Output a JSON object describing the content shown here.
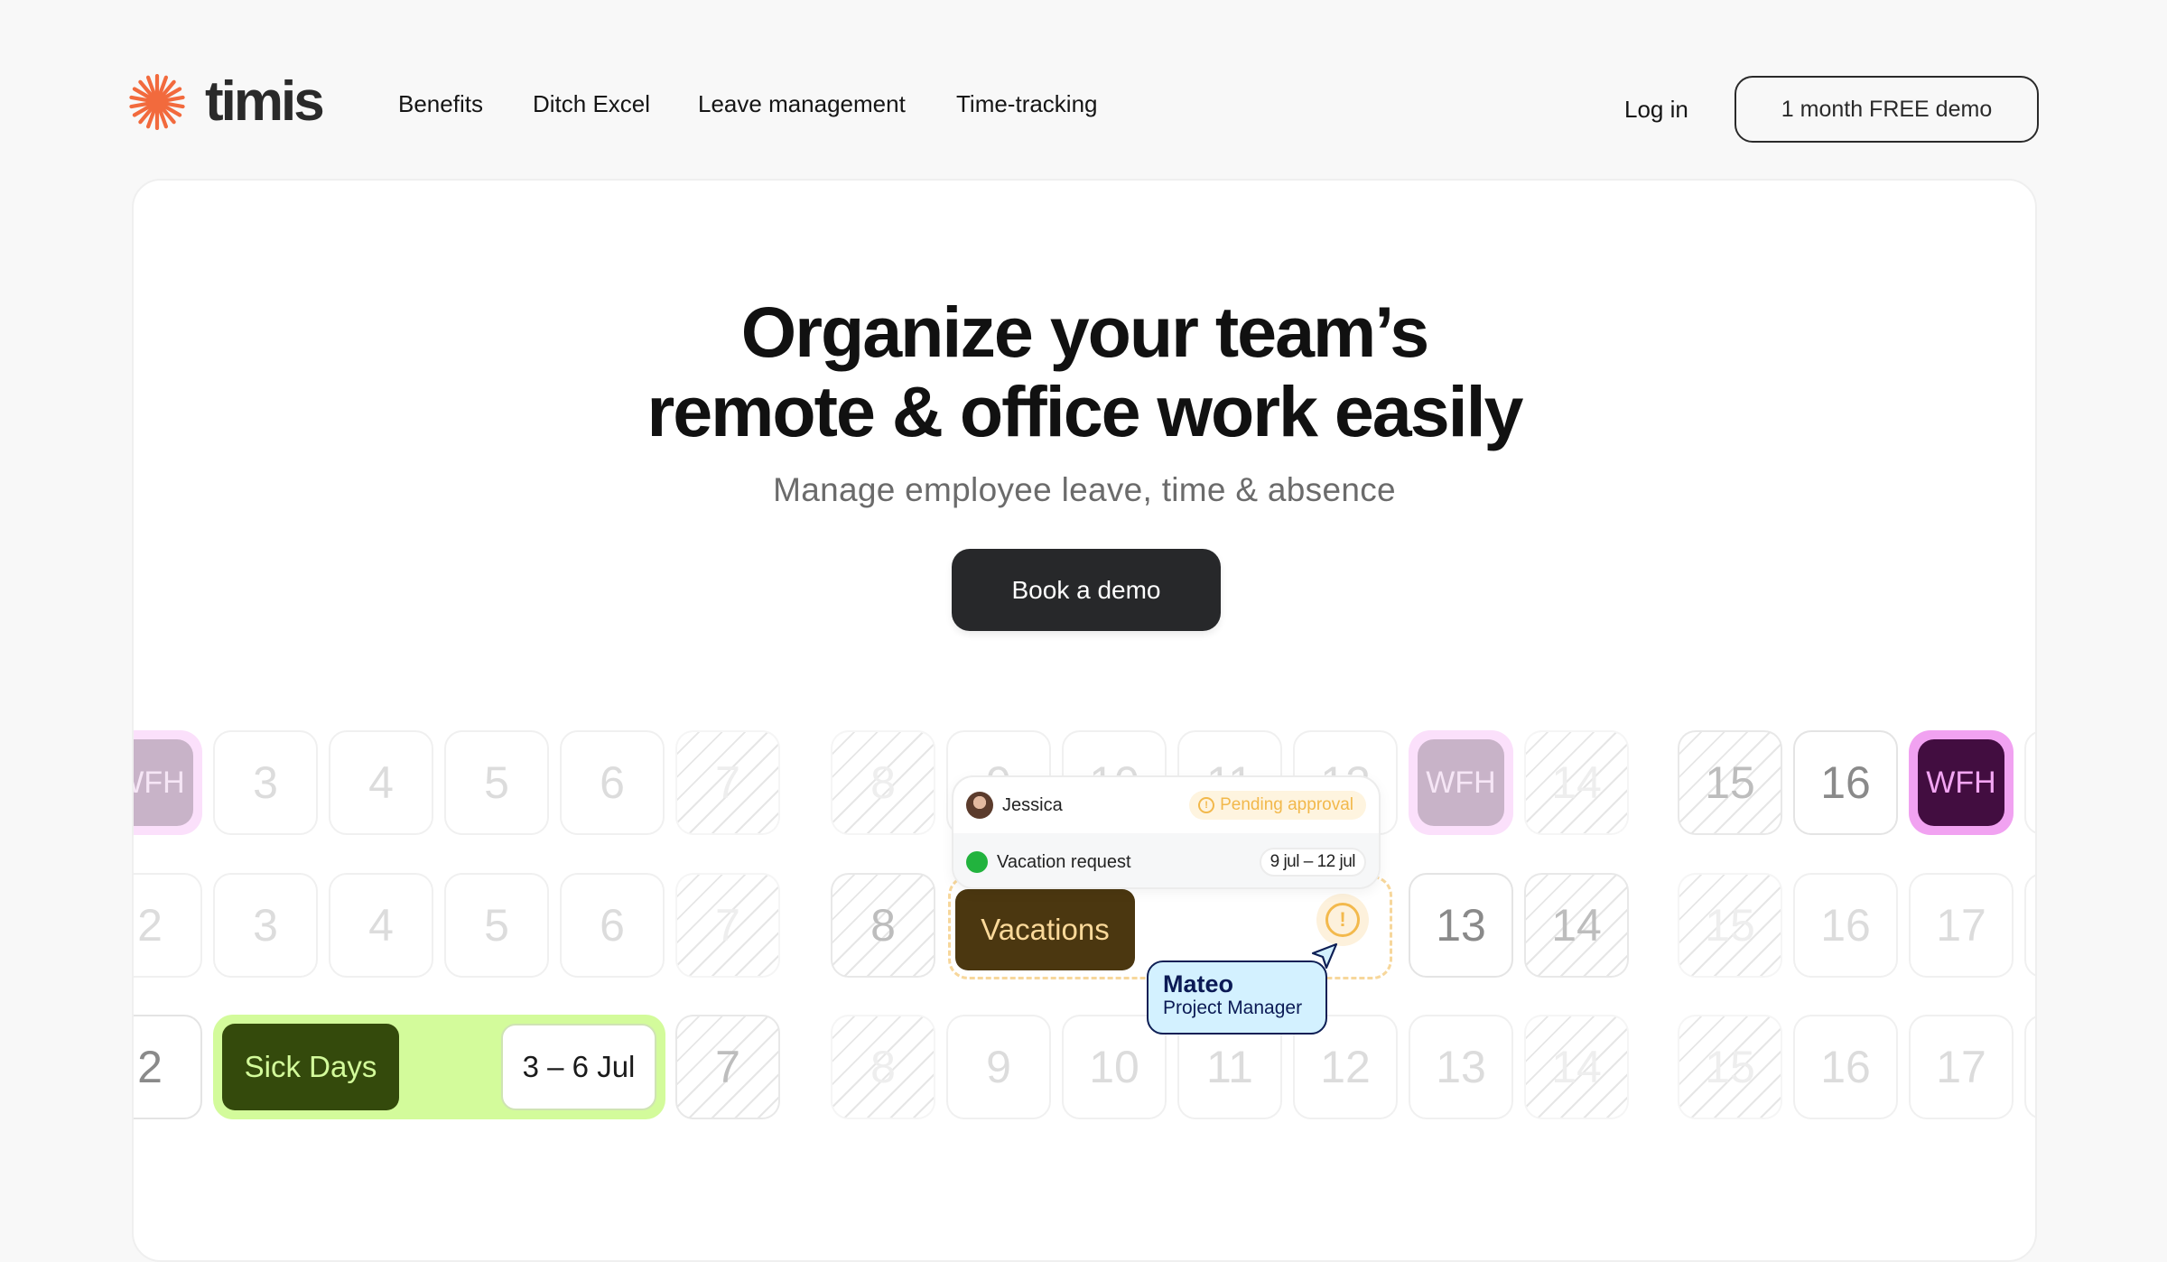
{
  "header": {
    "logo_text": "timis",
    "nav": [
      {
        "label": "Benefits"
      },
      {
        "label": "Ditch Excel"
      },
      {
        "label": "Leave management"
      },
      {
        "label": "Time-tracking"
      }
    ],
    "login_label": "Log in",
    "demo_label": "1 month FREE demo"
  },
  "hero": {
    "title_line1": "Organize your team’s",
    "title_line2": "remote & office work easily",
    "subtitle": "Manage employee leave, time & absence",
    "cta_label": "Book a demo"
  },
  "calendar": {
    "rows": [
      [
        "WFH",
        "3",
        "4",
        "5",
        "6",
        "7",
        "8",
        "9",
        "10",
        "11",
        "12",
        "WFH",
        "14",
        "15",
        "16",
        "WFH"
      ],
      [
        "2",
        "3",
        "4",
        "5",
        "6",
        "7",
        "8",
        "13",
        "14",
        "15",
        "16",
        "17"
      ],
      [
        "2",
        "7",
        "8",
        "9",
        "10",
        "11",
        "12",
        "13",
        "14",
        "15",
        "16",
        "17"
      ]
    ],
    "sick_days": {
      "label": "Sick Days",
      "range": "3 – 6 Jul"
    },
    "vacations": {
      "label": "Vacations"
    },
    "wfh_label": "WFH"
  },
  "request_popup": {
    "name": "Jessica",
    "status": "Pending approval",
    "request_type": "Vacation request",
    "date_range": "9 jul – 12 jul"
  },
  "tooltip": {
    "name": "Mateo",
    "role": "Project Manager"
  },
  "colors": {
    "brand": "#f26a3d",
    "sick_bg": "#d3fb9b",
    "sick_label": "#344a0c",
    "vacation": "#4b3710",
    "wfh_active": "#420d40",
    "pending": "#f2b84b",
    "tooltip_bg": "#d3f1ff"
  }
}
